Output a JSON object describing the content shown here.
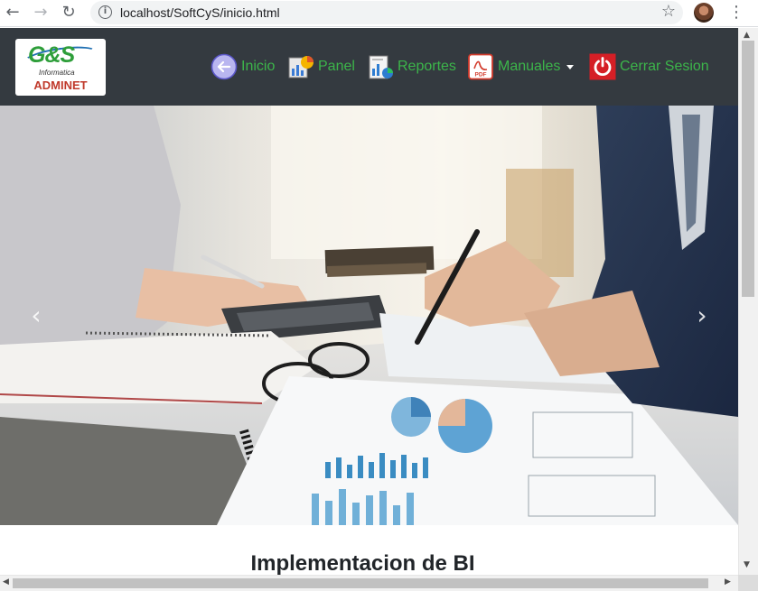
{
  "browser": {
    "url": "localhost/SoftCyS/inicio.html",
    "icons": [
      "back-icon",
      "forward-icon",
      "reload-icon",
      "info-icon",
      "star-icon",
      "profile-icon",
      "menu-icon"
    ]
  },
  "navbar": {
    "brand": {
      "logo_letters": "G&S",
      "logo_sub": "Informatica",
      "logo_name": "ADMINET"
    },
    "items": [
      {
        "label": "Inicio",
        "icon": "back-arrow-icon"
      },
      {
        "label": "Panel",
        "icon": "dashboard-icon"
      },
      {
        "label": "Reportes",
        "icon": "reports-icon"
      },
      {
        "label": "Manuales",
        "icon": "pdf-icon",
        "dropdown": true
      },
      {
        "label": "Cerrar Sesion",
        "icon": "power-icon"
      }
    ],
    "colors": {
      "background": "#343a40",
      "link": "#3cb54a"
    }
  },
  "carousel": {
    "prev_glyph": "‹",
    "next_glyph": "›",
    "image": "business-meeting-photo"
  },
  "main": {
    "section_title": "Implementacion de BI"
  }
}
